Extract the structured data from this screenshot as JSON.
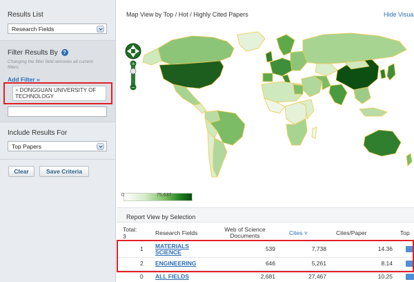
{
  "sidebar": {
    "results_list": {
      "heading": "Results List",
      "selected": "Research Fields"
    },
    "filter": {
      "heading": "Filter Results By",
      "hint": "Changing the filter field removes all current filters.",
      "add_filter": "Add Filter »",
      "chip_remove": "×",
      "chip_text": "DONGGUAN UNIVERSITY OF TECHNOLOGY"
    },
    "include": {
      "heading": "Include Results For",
      "selected": "Top Papers"
    },
    "buttons": {
      "clear": "Clear",
      "save": "Save Criteria"
    }
  },
  "map": {
    "title": "Map View by Top / Hot / Highly Cited Papers",
    "hide_link": "Hide Visua",
    "legend_min": "0",
    "legend_max": "75,637"
  },
  "report": {
    "title": "Report View by Selection",
    "headers": {
      "total": "Total:",
      "total_count": "3",
      "field": "Research Fields",
      "docs_line1": "Web of Science",
      "docs_line2": "Documents",
      "cites": "Cites",
      "cites_sort": "˅",
      "cites_per_paper": "Cites/Paper",
      "top": "Top"
    },
    "rows": [
      {
        "index": "1",
        "field_line1": "MATERIALS",
        "field_line2": "SCIENCE",
        "docs": "539",
        "cites": "7,738",
        "cpp": "14.36"
      },
      {
        "index": "2",
        "field_line1": "ENGINEERING",
        "field_line2": "",
        "docs": "646",
        "cites": "5,261",
        "cpp": "8.14"
      },
      {
        "index": "0",
        "field_line1": "ALL FIELDS",
        "field_line2": "",
        "docs": "2,681",
        "cites": "27,467",
        "cpp": "10.25"
      }
    ]
  },
  "colors": {
    "accent": "#2a6db5",
    "highlight": "#e21f26",
    "map_dark": "#1d6b1f"
  }
}
